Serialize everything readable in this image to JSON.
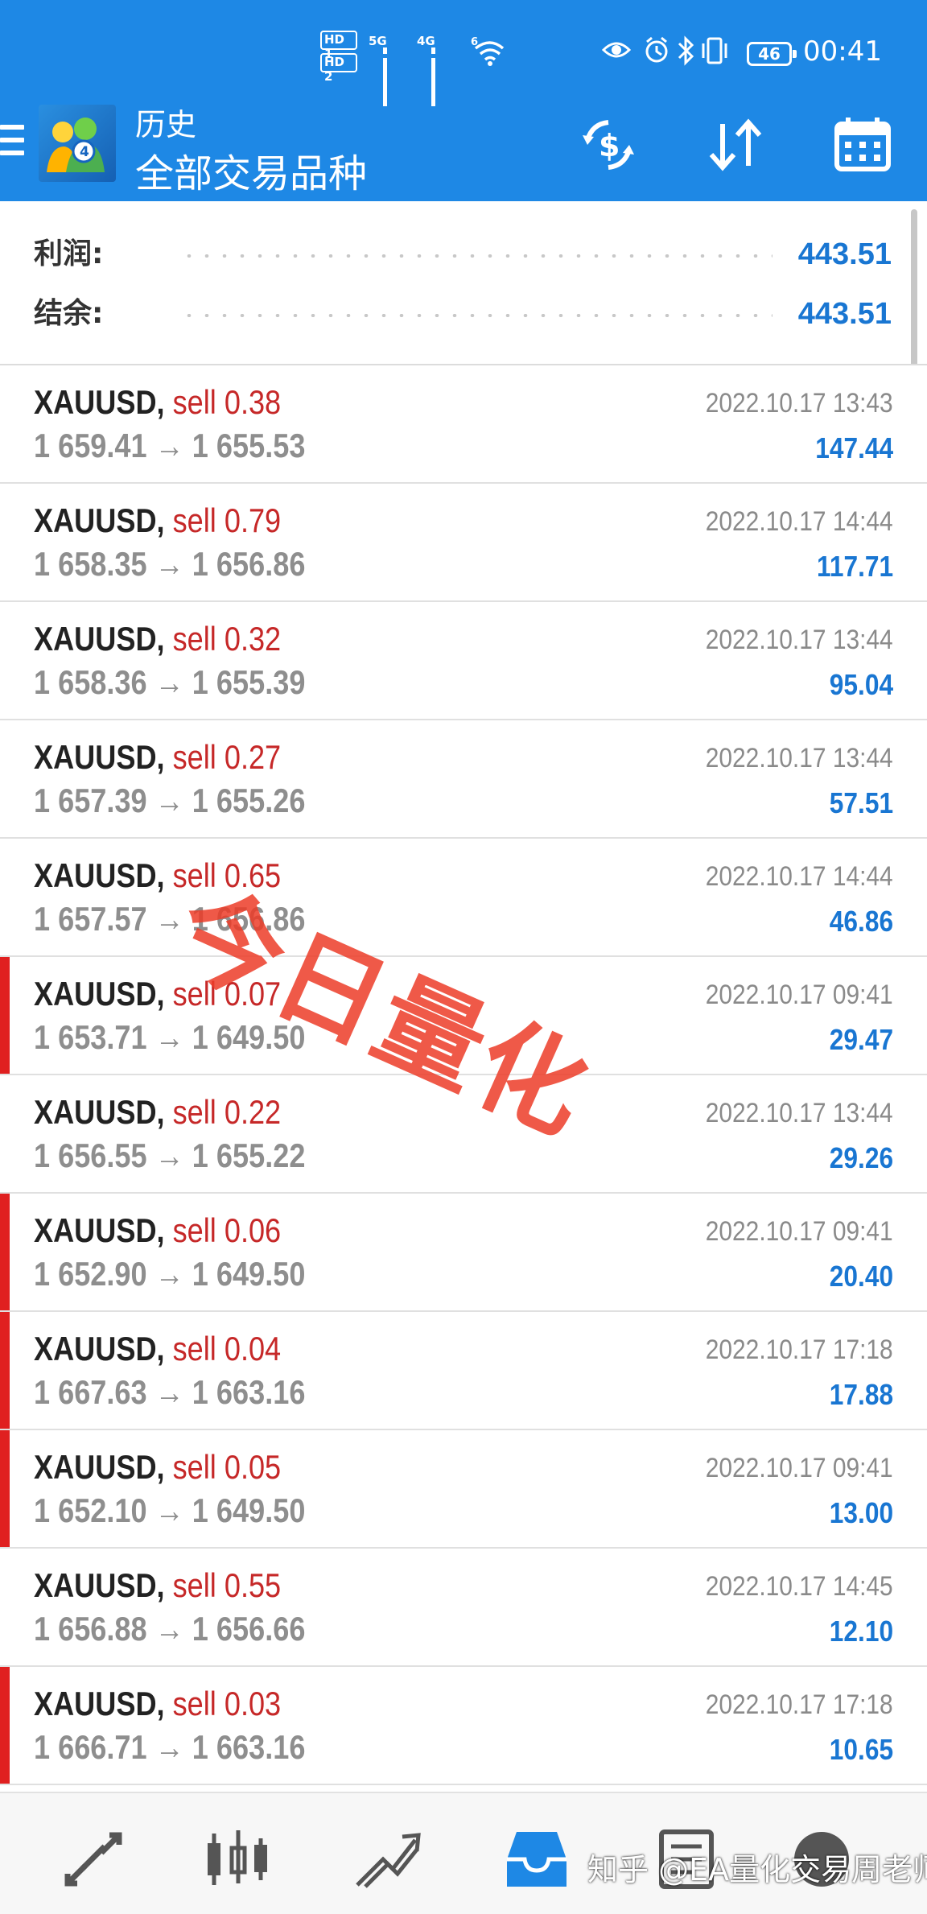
{
  "status_bar": {
    "sim1": "HD 1",
    "sim2": "HD 2",
    "net1": "5G",
    "net2": "4G",
    "net3": "6",
    "battery": "46",
    "time": "00:41"
  },
  "toolbar": {
    "title": "历史",
    "subtitle": "全部交易品种",
    "icons": [
      "exchange-dollar-icon",
      "sort-icon",
      "calendar-icon"
    ]
  },
  "summary": {
    "profit_label": "利润:",
    "profit_value": "443.51",
    "balance_label": "结余:",
    "balance_value": "443.51"
  },
  "deals": [
    {
      "symbol": "XAUUSD,",
      "type": "sell",
      "volume": "0.38",
      "open": "1 659.41",
      "close": "1 655.53",
      "time": "2022.10.17 13:43",
      "profit": "147.44",
      "marker": false
    },
    {
      "symbol": "XAUUSD,",
      "type": "sell",
      "volume": "0.79",
      "open": "1 658.35",
      "close": "1 656.86",
      "time": "2022.10.17 14:44",
      "profit": "117.71",
      "marker": false
    },
    {
      "symbol": "XAUUSD,",
      "type": "sell",
      "volume": "0.32",
      "open": "1 658.36",
      "close": "1 655.39",
      "time": "2022.10.17 13:44",
      "profit": "95.04",
      "marker": false
    },
    {
      "symbol": "XAUUSD,",
      "type": "sell",
      "volume": "0.27",
      "open": "1 657.39",
      "close": "1 655.26",
      "time": "2022.10.17 13:44",
      "profit": "57.51",
      "marker": false
    },
    {
      "symbol": "XAUUSD,",
      "type": "sell",
      "volume": "0.65",
      "open": "1 657.57",
      "close": "1 656.86",
      "time": "2022.10.17 14:44",
      "profit": "46.86",
      "marker": false
    },
    {
      "symbol": "XAUUSD,",
      "type": "sell",
      "volume": "0.07",
      "open": "1 653.71",
      "close": "1 649.50",
      "time": "2022.10.17 09:41",
      "profit": "29.47",
      "marker": true
    },
    {
      "symbol": "XAUUSD,",
      "type": "sell",
      "volume": "0.22",
      "open": "1 656.55",
      "close": "1 655.22",
      "time": "2022.10.17 13:44",
      "profit": "29.26",
      "marker": false
    },
    {
      "symbol": "XAUUSD,",
      "type": "sell",
      "volume": "0.06",
      "open": "1 652.90",
      "close": "1 649.50",
      "time": "2022.10.17 09:41",
      "profit": "20.40",
      "marker": true
    },
    {
      "symbol": "XAUUSD,",
      "type": "sell",
      "volume": "0.04",
      "open": "1 667.63",
      "close": "1 663.16",
      "time": "2022.10.17 17:18",
      "profit": "17.88",
      "marker": true
    },
    {
      "symbol": "XAUUSD,",
      "type": "sell",
      "volume": "0.05",
      "open": "1 652.10",
      "close": "1 649.50",
      "time": "2022.10.17 09:41",
      "profit": "13.00",
      "marker": true
    },
    {
      "symbol": "XAUUSD,",
      "type": "sell",
      "volume": "0.55",
      "open": "1 656.88",
      "close": "1 656.66",
      "time": "2022.10.17 14:45",
      "profit": "12.10",
      "marker": false
    },
    {
      "symbol": "XAUUSD,",
      "type": "sell",
      "volume": "0.03",
      "open": "1 666.71",
      "close": "1 663.16",
      "time": "2022.10.17 17:18",
      "profit": "10.65",
      "marker": true
    }
  ],
  "arrow": "→",
  "watermark": "今日量化",
  "bottom_nav": {
    "items": [
      "quotes-icon",
      "chart-icon",
      "trade-icon",
      "history-icon",
      "news-icon",
      "settings-icon"
    ],
    "active": "history-icon"
  },
  "credit": "知乎 @EA量化交易周老师",
  "colors": {
    "appbar": "#1e88e5",
    "sell": "#c62828",
    "profit": "#1976d2",
    "marker": "#e02020"
  }
}
